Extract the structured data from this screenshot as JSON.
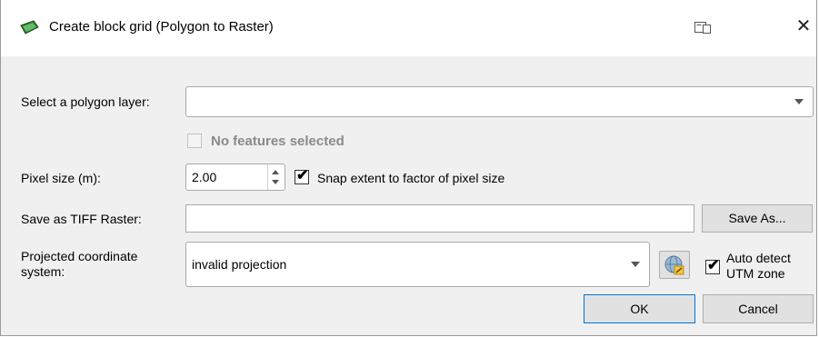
{
  "window": {
    "title": "Create block grid (Polygon to Raster)",
    "close_glyph": "✕"
  },
  "polygon_layer": {
    "label": "Select a polygon layer:",
    "value": ""
  },
  "features": {
    "label": "No features selected",
    "checked": false,
    "enabled": false
  },
  "pixel_size": {
    "label": "Pixel size (m):",
    "value": "2.00"
  },
  "snap": {
    "label": "Snap extent to factor of pixel size",
    "checked": true
  },
  "save": {
    "label": "Save as TIFF Raster:",
    "value": "",
    "button": "Save As..."
  },
  "crs": {
    "label_line1": "Projected coordinate",
    "label_line2": "system:",
    "value": "invalid projection"
  },
  "utm": {
    "label_line1": "Auto detect",
    "label_line2": "UTM zone",
    "checked": true
  },
  "buttons": {
    "ok": "OK",
    "cancel": "Cancel"
  },
  "check_glyph": "✔",
  "colors": {
    "accent": "#0078d7",
    "dialog_bg": "#f0f0f0",
    "icon_green": "#2e7d32"
  }
}
